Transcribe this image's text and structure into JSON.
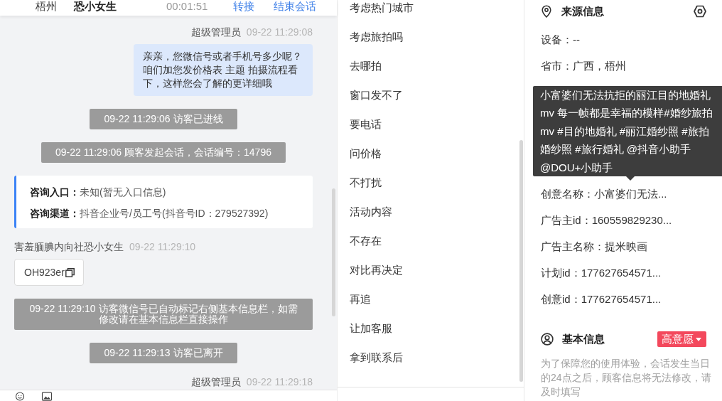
{
  "chat_header": {
    "location": "梧州",
    "contact_name": "恐小女生",
    "duration": "00:01:51",
    "actions": [
      {
        "text": "转接"
      },
      {
        "text": "结束会话"
      }
    ]
  },
  "messages": [
    {
      "kind": "agent",
      "sender": "超级管理员",
      "time": "09-22 11:29:08",
      "text": "亲亲，您微信号或者手机号多少呢？咱们加您发价格表 主题 拍摄流程看下，这样您会了解的更详细哦"
    },
    {
      "kind": "system",
      "text": "09-22 11:29:06 访客已进线"
    },
    {
      "kind": "system",
      "text": "09-22 11:29:06 顾客发起会话，会话编号：14796"
    },
    {
      "kind": "info_card",
      "lines": [
        {
          "text": "**咨询入口：**未知(暂无入口信息)"
        },
        {
          "text": "**咨询渠道：**抖音企业号/员工号(抖音号ID：279527392)"
        }
      ]
    },
    {
      "kind": "visitor",
      "sender": "害羞腼腆内向社恐小女生",
      "time": "09-22 11:29:10",
      "text": "OH923er"
    },
    {
      "kind": "system",
      "text": "09-22 11:29:10 访客微信号已自动标记右侧基本信息栏，如需修改请在基本信息栏直接操作"
    },
    {
      "kind": "system",
      "text": "09-22 11:29:13 访客已离开"
    },
    {
      "kind": "agent",
      "sender": "超级管理员",
      "time": "09-22 11:29:18"
    }
  ],
  "quick_replies": [
    {
      "text": "考虑热门城市"
    },
    {
      "text": "考虑旅拍吗"
    },
    {
      "text": "去哪拍"
    },
    {
      "text": "窗口发不了"
    },
    {
      "text": "要电话"
    },
    {
      "text": "问价格"
    },
    {
      "text": "不打扰"
    },
    {
      "text": "活动内容"
    },
    {
      "text": "不存在"
    },
    {
      "text": "对比再决定"
    },
    {
      "text": "再追"
    },
    {
      "text": "让加客服"
    },
    {
      "text": "拿到联系后"
    }
  ],
  "source_info": {
    "title": "来源信息",
    "rows": [
      {
        "kind": "field",
        "text": "设备：--"
      },
      {
        "kind": "field",
        "text": "省市：广西，梧州"
      },
      {
        "kind": "tooltip",
        "text": "小富婆们无法抗拒的丽江目的地婚礼mv 每一帧都是幸福的模样#婚纱旅拍mv #目的地婚礼 #丽江婚纱照 #旅拍婚纱照 #旅行婚礼 @抖音小助手 @DOU+小助手"
      },
      {
        "kind": "field",
        "text": "创意名称：小富婆们无法..."
      },
      {
        "kind": "field",
        "text": "广告主id：160559829230..."
      },
      {
        "kind": "field",
        "text": "广告主名称：提米映画"
      },
      {
        "kind": "field",
        "text": "计划id：177627654571..."
      },
      {
        "kind": "field",
        "text": "创意id：177627654571..."
      }
    ]
  },
  "basic_info": {
    "title": "基本信息",
    "intent_badge": "高意愿",
    "note": "为了保障您的使用体验，会话发生当日的24点之后，顾客信息将无法修改，请及时填写"
  }
}
